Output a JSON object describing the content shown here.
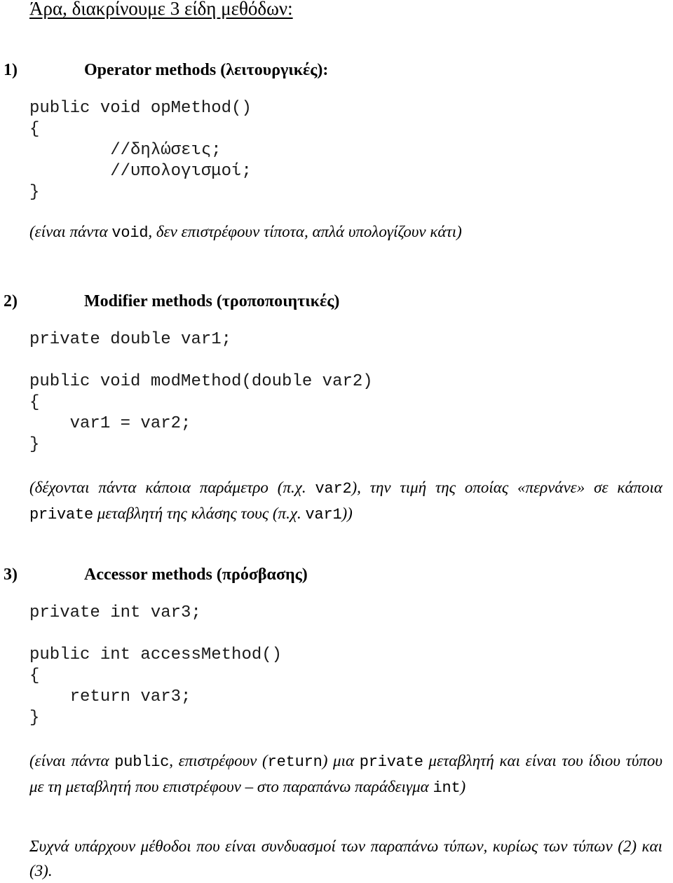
{
  "document": {
    "title": "Άρα, διακρίνουμε 3 είδη μεθόδων:"
  },
  "sections": [
    {
      "marker": "1)",
      "heading": "Operator methods (λειτουργικές):",
      "code": "public void opMethod()\n{\n        //δηλώσεις;\n        //υπολογισμοί;\n}",
      "note_parts": {
        "p1": "(είναι πάντα ",
        "c1": "void",
        "p2": ", δεν επιστρέφουν τίποτα, απλά υπολογίζουν κάτι)"
      }
    },
    {
      "marker": "2)",
      "heading": "Modifier methods (τροποποιητικές)",
      "code_decl": "private double var1;",
      "code": "public void modMethod(double var2)\n{\n    var1 = var2;\n}",
      "note_parts": {
        "p1": "(δέχονται πάντα κάποια παράμετρο (π.χ. ",
        "c1": "var2",
        "p2": "), την τιμή της οποίας «περνάνε» σε κάποια ",
        "c2": "private",
        "p3": " μεταβλητή της κλάσης τους (π.χ. ",
        "c3": "var1",
        "p4": "))"
      }
    },
    {
      "marker": "3)",
      "heading": "Accessor methods (πρόσβασης)",
      "code_decl": "private int var3;",
      "code": "public int accessMethod()\n{\n    return var3;\n}",
      "note_parts": {
        "p1": "(είναι πάντα ",
        "c1": "public",
        "p2": ", επιστρέφουν (",
        "c2": "return",
        "p3": ") μια ",
        "c3": "private",
        "p4": " μεταβλητή και είναι του ίδιου τύπου με τη μεταβλητή που επιστρέφουν – στο παραπάνω παράδειγμα ",
        "c4": "int",
        "p5": ")"
      }
    }
  ],
  "closing": {
    "text": "Συχνά υπάρχουν μέθοδοι που είναι συνδυασμοί των παραπάνω τύπων, κυρίως των τύπων (2) και (3)."
  }
}
